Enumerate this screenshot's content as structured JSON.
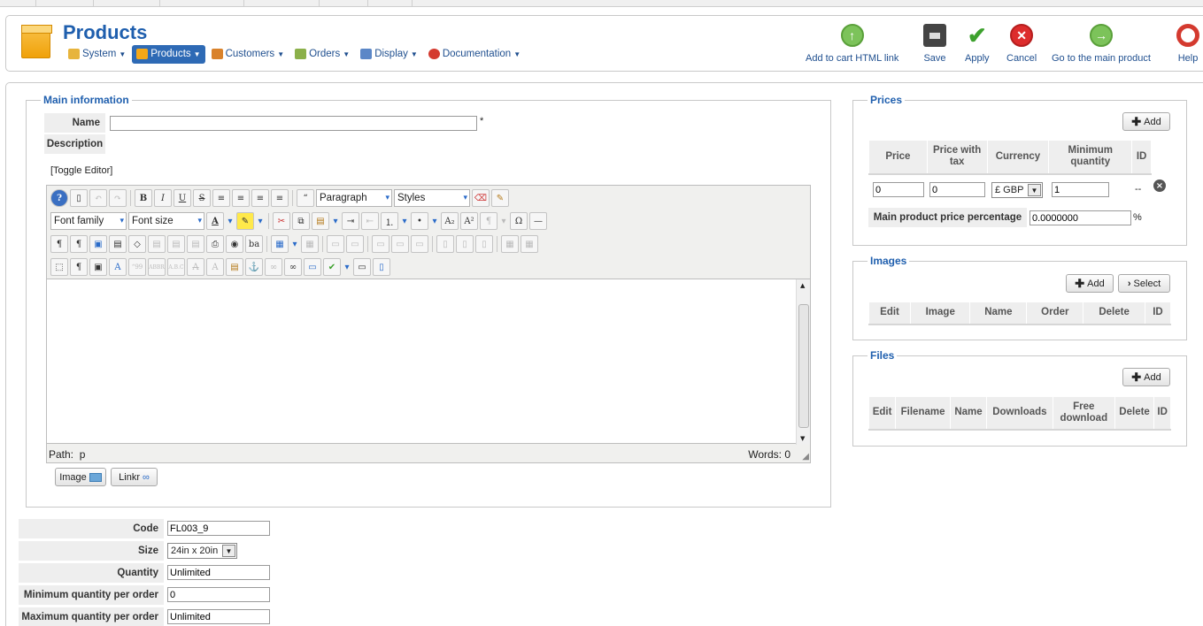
{
  "header": {
    "title": "Products",
    "menu": [
      {
        "label": "System",
        "icon": "tools-icon",
        "color": "#e7b43c"
      },
      {
        "label": "Products",
        "icon": "box-icon",
        "color": "#f5a818"
      },
      {
        "label": "Customers",
        "icon": "users-icon",
        "color": "#d9822b"
      },
      {
        "label": "Orders",
        "icon": "orders-icon",
        "color": "#8bb04a"
      },
      {
        "label": "Display",
        "icon": "display-icon",
        "color": "#5b87c7"
      },
      {
        "label": "Documentation",
        "icon": "lifebuoy-icon",
        "color": "#d43a2f"
      }
    ],
    "toolbar": {
      "add_cart_link": "Add to cart HTML link",
      "save": "Save",
      "apply": "Apply",
      "cancel": "Cancel",
      "main_product": "Go to the main product",
      "help": "Help"
    }
  },
  "main_info": {
    "legend": "Main information",
    "name_label": "Name",
    "name_value": "",
    "required_mark": "*",
    "description_label": "Description",
    "toggle_editor": "[Toggle Editor]",
    "format_select": "Paragraph",
    "styles_select": "Styles",
    "font_family": "Font family",
    "font_size": "Font size",
    "path_label": "Path:",
    "path_value": "p",
    "words_label": "Words: 0",
    "image_btn": "Image",
    "link_btn": "Linkr"
  },
  "fields": {
    "code_label": "Code",
    "code_value": "FL003_9",
    "size_label": "Size",
    "size_value": "24in x 20in",
    "quantity_label": "Quantity",
    "quantity_value": "Unlimited",
    "minq_label": "Minimum quantity per order",
    "minq_value": "0",
    "maxq_label": "Maximum quantity per order",
    "maxq_value": "Unlimited"
  },
  "prices": {
    "legend": "Prices",
    "add": "Add",
    "columns": [
      "Price",
      "Price with tax",
      "Currency",
      "Minimum quantity",
      "ID"
    ],
    "row": {
      "price": "0",
      "price_tax": "0",
      "currency": "£ GBP",
      "min_qty": "1",
      "id": "--"
    },
    "percentage_label": "Main product price percentage",
    "percentage_value": "0.0000000",
    "percent_sign": "%"
  },
  "images": {
    "legend": "Images",
    "add": "Add",
    "select": "Select",
    "columns": [
      "Edit",
      "Image",
      "Name",
      "Order",
      "Delete",
      "ID"
    ]
  },
  "files": {
    "legend": "Files",
    "add": "Add",
    "columns": [
      "Edit",
      "Filename",
      "Name",
      "Downloads",
      "Free download",
      "Delete",
      "ID"
    ]
  }
}
